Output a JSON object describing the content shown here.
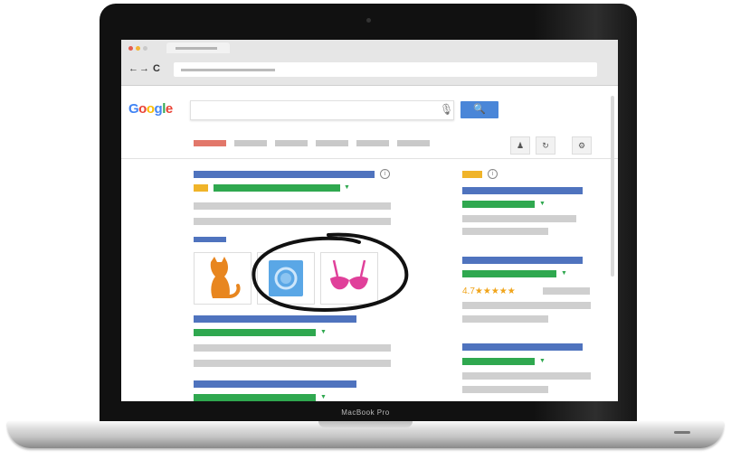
{
  "laptop": {
    "model_label": "MacBook Pro"
  },
  "browser": {
    "back_glyph": "←",
    "forward_glyph": "→",
    "reload_glyph": "C"
  },
  "search_page": {
    "logo": [
      "G",
      "o",
      "o",
      "g",
      "l",
      "e"
    ],
    "search_button_glyph": "🔍",
    "mic_glyph": "🎙",
    "info_glyph": "i",
    "rating_text": "4.7★★★★★",
    "tool_glyphs": [
      "♟",
      "↻",
      "⚙"
    ],
    "caret_glyph": "▼"
  },
  "images": [
    {
      "icon": "cat-icon",
      "color": "#e8861f"
    },
    {
      "icon": "condom-icon",
      "color": "#5aa7e6"
    },
    {
      "icon": "bra-icon",
      "color": "#e0409a"
    }
  ],
  "colors": {
    "blue": "#4f73be",
    "green": "#2fa84f",
    "yellow": "#f0b429",
    "tab_active": "#e2776a"
  }
}
